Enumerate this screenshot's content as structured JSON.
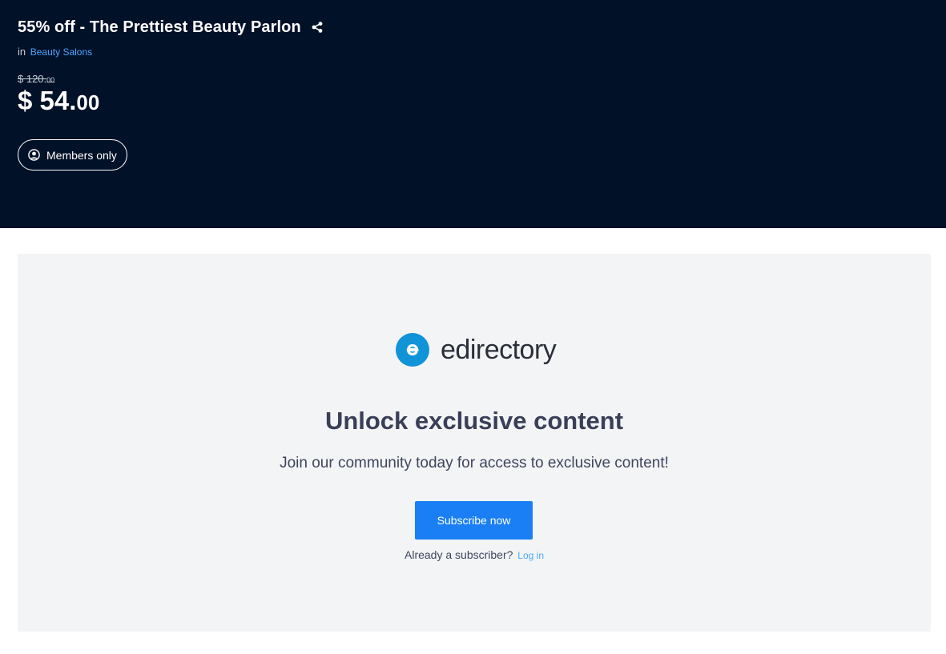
{
  "deal": {
    "title": "55% off - The Prettiest Beauty Parlon",
    "category_prefix": "in",
    "category": "Beauty Salons",
    "old_price_main": "$ 120.",
    "old_price_cents": "00",
    "new_price_main": "$ 54.",
    "new_price_cents": "00",
    "members_label": "Members only"
  },
  "paywall": {
    "logo_text": "edirectory",
    "heading": "Unlock exclusive content",
    "subheading": "Join our community today for access to exclusive content!",
    "subscribe_label": "Subscribe now",
    "already_text": "Already a subscriber?",
    "login_label": "Log in"
  },
  "icons": {
    "share": "share-icon",
    "user": "user-circle-icon",
    "logo": "edirectory-logo-icon"
  },
  "colors": {
    "hero_bg": "#001128",
    "link": "#4aa6ff",
    "button": "#1a7ff5",
    "logo": "#1193d8",
    "panel_bg": "#f3f4f6"
  }
}
